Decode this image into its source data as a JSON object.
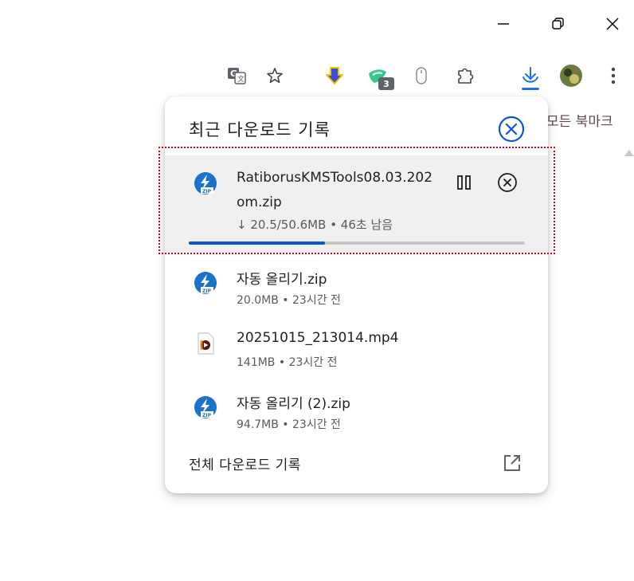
{
  "window": {
    "minimize_icon": "minimize-icon",
    "restore_icon": "restore-icon",
    "close_icon": "close-icon"
  },
  "toolbar": {
    "icons": [
      "translate-icon",
      "star-icon",
      "extension-download-arrow-icon",
      "extension-shield-icon",
      "mouse-icon",
      "puzzle-icon",
      "download-icon",
      "profile-avatar",
      "more-menu-icon"
    ],
    "badge_count": "3",
    "accent": "#1a73e8"
  },
  "bookmarks": {
    "all_bookmarks": "모든 북마크"
  },
  "downloads": {
    "title": "최근 다운로드 기록",
    "active": {
      "name_line1": "RatiborusKMSTools08.03.202",
      "name_line2": "om.zip",
      "status": "↓ 20.5/50.6MB • 46초 남음",
      "progress_percent": 40.5,
      "icon": "zip-file-icon"
    },
    "items": [
      {
        "name": "자동 올리기.zip",
        "meta": "20.0MB • 23시간 전",
        "icon": "zip-file-icon"
      },
      {
        "name": "20251015_213014.mp4",
        "meta": "141MB • 23시간 전",
        "icon": "video-file-icon"
      },
      {
        "name": "자동 올리기 (2).zip",
        "meta": "94.7MB • 23시간 전",
        "icon": "zip-file-icon"
      }
    ],
    "footer_label": "전체 다운로드 기록",
    "colors": {
      "progress_fill": "#0b57d0",
      "progress_track": "#c6c6c6",
      "highlight_border": "#d8001e"
    }
  }
}
